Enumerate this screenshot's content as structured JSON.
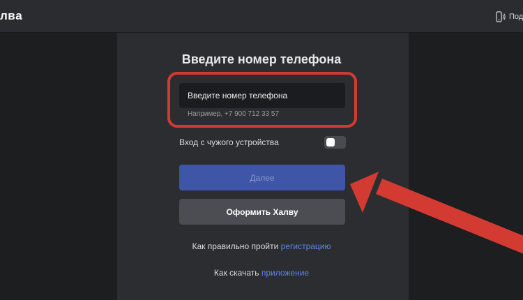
{
  "header": {
    "logo_text": "лвa",
    "phone_link_label": "Под"
  },
  "form": {
    "title": "Введите номер телефона",
    "phone_input_label": "Введите номер телефона",
    "phone_hint": "Например, +7 900 712 33 57",
    "other_device_label": "Вход с чужого устройства",
    "other_device_toggle": false,
    "next_button_label": "Далее",
    "apply_button_label": "Оформить Халву",
    "registration_prefix": "Как правильно пройти ",
    "registration_link": "регистрацию",
    "app_prefix": "Как скачать ",
    "app_link": "приложение"
  },
  "annotation": {
    "highlight_color": "#d23a32",
    "accent_color": "#3e55a8",
    "link_color": "#5d86e6"
  }
}
